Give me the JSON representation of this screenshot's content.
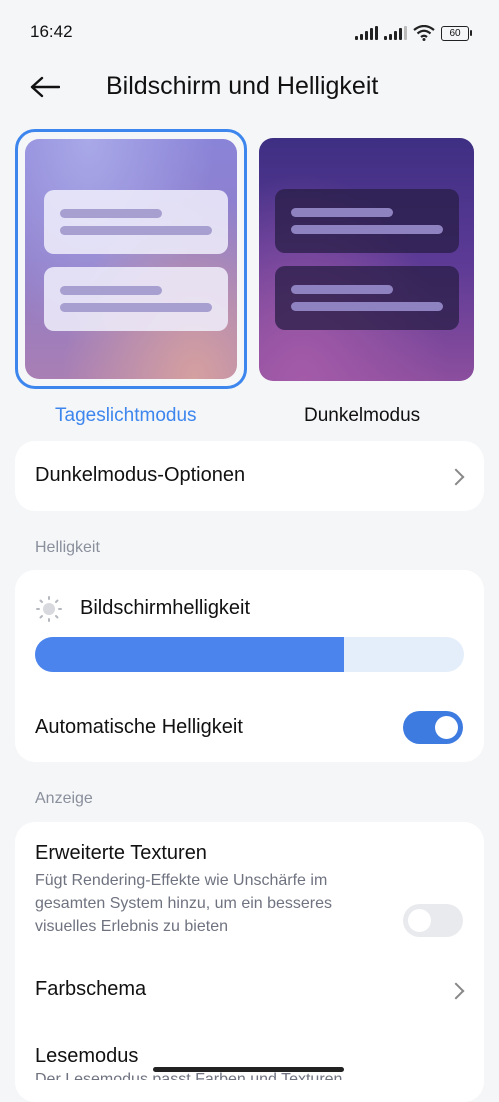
{
  "status_bar": {
    "time": "16:42",
    "battery": "60"
  },
  "header": {
    "title": "Bildschirm und Helligkeit",
    "back_icon": "arrow-left-icon"
  },
  "themes": {
    "light_label": "Tageslichtmodus",
    "dark_label": "Dunkelmodus",
    "selected": "light",
    "accent_color": "#3d86ee"
  },
  "dark_mode_options": {
    "label": "Dunkelmodus-Optionen"
  },
  "brightness_section": {
    "header": "Helligkeit",
    "screen_brightness_label": "Bildschirmhelligkeit",
    "brightness_level_percent": 72,
    "auto_brightness_label": "Automatische Helligkeit",
    "auto_brightness_on": true
  },
  "display_section": {
    "header": "Anzeige",
    "advanced_textures_label": "Erweiterte Texturen",
    "advanced_textures_desc": "Fügt Rendering-Effekte wie Unschärfe im gesamten System hinzu, um ein besseres visuelles Erlebnis zu bieten",
    "advanced_textures_on": false,
    "color_scheme_label": "Farbschema",
    "reading_mode_label": "Lesemodus",
    "reading_mode_desc": "Der Lesemodus passt Farben und Texturen"
  }
}
